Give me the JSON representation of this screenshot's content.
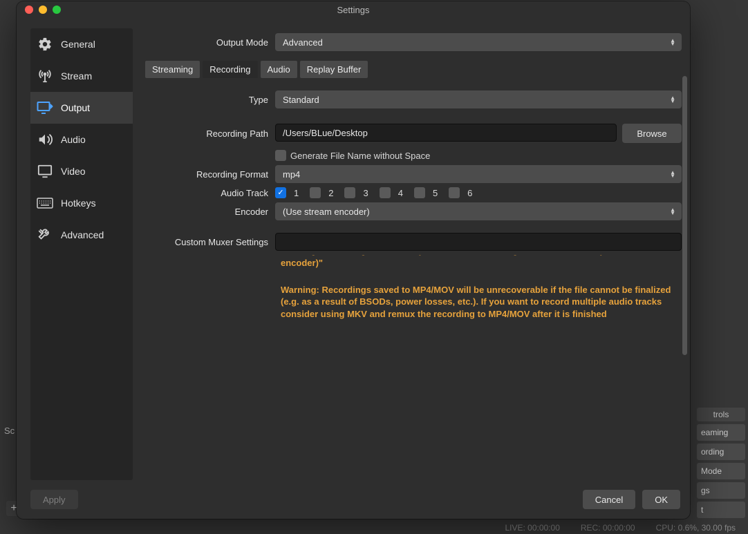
{
  "window": {
    "title": "Settings"
  },
  "sidebar": {
    "items": [
      {
        "label": "General"
      },
      {
        "label": "Stream"
      },
      {
        "label": "Output"
      },
      {
        "label": "Audio"
      },
      {
        "label": "Video"
      },
      {
        "label": "Hotkeys"
      },
      {
        "label": "Advanced"
      }
    ],
    "active_index": 2
  },
  "content": {
    "output_mode_label": "Output Mode",
    "output_mode_value": "Advanced",
    "tabs": [
      {
        "label": "Streaming"
      },
      {
        "label": "Recording"
      },
      {
        "label": "Audio"
      },
      {
        "label": "Replay Buffer"
      }
    ],
    "active_tab_index": 1,
    "type_label": "Type",
    "type_value": "Standard",
    "rec_path_label": "Recording Path",
    "rec_path_value": "/Users/BLue/Desktop",
    "browse_label": "Browse",
    "gen_filename_label": "Generate File Name without Space",
    "gen_filename_checked": false,
    "rec_format_label": "Recording Format",
    "rec_format_value": "mp4",
    "audio_track_label": "Audio Track",
    "audio_tracks": [
      {
        "n": "1",
        "checked": true
      },
      {
        "n": "2",
        "checked": false
      },
      {
        "n": "3",
        "checked": false
      },
      {
        "n": "4",
        "checked": false
      },
      {
        "n": "5",
        "checked": false
      },
      {
        "n": "6",
        "checked": false
      }
    ],
    "encoder_label": "Encoder",
    "encoder_value": "(Use stream encoder)",
    "muxer_label": "Custom Muxer Settings",
    "muxer_value": "",
    "warning_partial_top": "Warning: Recordings cannot be paused if the recording encoder is set to \"(Use stream encoder)\"",
    "warning_full": "Warning: Recordings saved to MP4/MOV will be unrecoverable if the file cannot be finalized (e.g. as a result of BSODs, power losses, etc.). If you want to record multiple audio tracks consider using MKV and remux the recording to MP4/MOV after it is finished"
  },
  "buttons": {
    "apply": "Apply",
    "cancel": "Cancel",
    "ok": "OK"
  },
  "background": {
    "sc": "Sc",
    "controls_header": "trols",
    "controls": [
      "eaming",
      "ording",
      "Mode",
      "gs",
      "t"
    ],
    "status": {
      "live": "LIVE: 00:00:00",
      "rec": "REC: 00:00:00",
      "cpu": "CPU: 0.6%, 30.00 fps"
    }
  }
}
